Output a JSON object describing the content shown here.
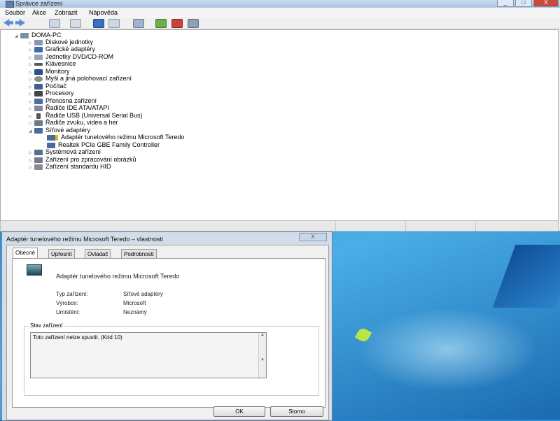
{
  "window": {
    "title": "Správce zařízení",
    "buttons": [
      "_",
      "□",
      "X"
    ]
  },
  "menu": [
    "Soubor",
    "Akce",
    "Zobrazit",
    "Nápověda"
  ],
  "toolbar_icons": [
    "back-icon",
    "forward-icon",
    "properties-icon",
    "view-icon",
    "help-icon",
    "console-icon",
    "scan-icon",
    "update-driver-icon",
    "uninstall-icon",
    "disable-icon"
  ],
  "tree": {
    "root": "DOMA-PC",
    "items": [
      {
        "label": "Diskové jednotky",
        "icon": "disk-icon"
      },
      {
        "label": "Grafické adaptéry",
        "icon": "display-adapter-icon"
      },
      {
        "label": "Jednotky DVD/CD-ROM",
        "icon": "dvd-icon"
      },
      {
        "label": "Klávesnice",
        "icon": "keyboard-icon"
      },
      {
        "label": "Monitory",
        "icon": "monitor-icon"
      },
      {
        "label": "Myši a jiná polohovací zařízení",
        "icon": "mouse-icon"
      },
      {
        "label": "Počítač",
        "icon": "computer-icon"
      },
      {
        "label": "Procesory",
        "icon": "processor-icon"
      },
      {
        "label": "Přenosná zařízení",
        "icon": "portable-device-icon"
      },
      {
        "label": "Řadiče IDE ATA/ATAPI",
        "icon": "ide-icon"
      },
      {
        "label": "Řadiče USB (Universal Serial Bus)",
        "icon": "usb-icon"
      },
      {
        "label": "Řadiče zvuku, videa a her",
        "icon": "sound-icon"
      },
      {
        "label": "Síťové adaptéry",
        "icon": "network-icon",
        "expanded": true,
        "children": [
          {
            "label": "Adaptér tunelového režimu Microsoft Teredo",
            "icon": "network-warning-icon"
          },
          {
            "label": "Realtek PCIe GBE Family Controller",
            "icon": "network-icon"
          }
        ]
      },
      {
        "label": "Systémová zařízení",
        "icon": "system-icon"
      },
      {
        "label": "Zařízení pro zpracování obrázků",
        "icon": "imaging-icon"
      },
      {
        "label": "Zařízení standardu HID",
        "icon": "hid-icon"
      }
    ]
  },
  "dialog": {
    "title": "Adaptér tunelového režimu Microsoft Teredo – vlastnosti",
    "close": "X",
    "tabs": [
      "Obecné",
      "Upřesnit",
      "Ovladač",
      "Podrobnosti"
    ],
    "device_name": "Adaptér tunelového režimu Microsoft Teredo",
    "props": [
      {
        "label": "Typ zařízení:",
        "value": "Síťové adaptéry"
      },
      {
        "label": "Výrobce:",
        "value": "Microsoft"
      },
      {
        "label": "Umístění:",
        "value": "Neznámý"
      }
    ],
    "status_group": "Stav zařízení",
    "status_text": "Toto zařízení nelze spustit. (Kód 10)",
    "ok": "OK",
    "cancel": "Storno"
  },
  "colors": {
    "warning": "#e8b020",
    "tree_icon": "#4a6a9a",
    "accent": "#2d8fd4"
  }
}
